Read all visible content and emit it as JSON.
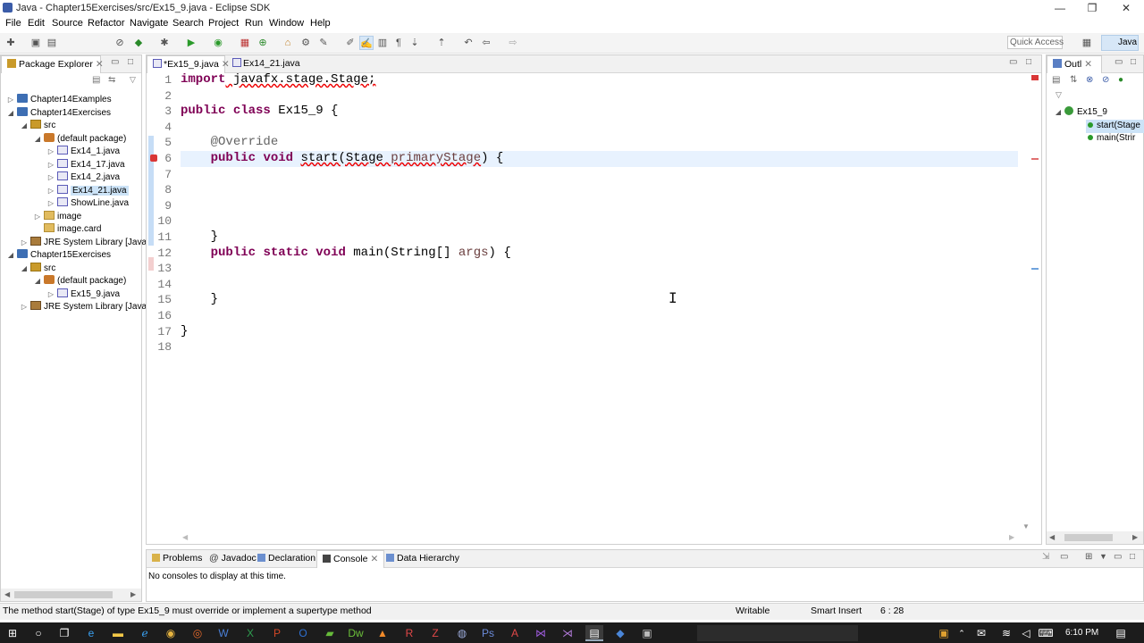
{
  "window": {
    "title": "Java - Chapter15Exercises/src/Ex15_9.java - Eclipse SDK",
    "minimize": "—",
    "restore": "❐",
    "close": "✕"
  },
  "menu": [
    "File",
    "Edit",
    "Source",
    "Refactor",
    "Navigate",
    "Search",
    "Project",
    "Run",
    "Window",
    "Help"
  ],
  "toolbar": {
    "quick_access_placeholder": "Quick Access",
    "perspective": "Java"
  },
  "package_explorer": {
    "title": "Package Explorer",
    "items": [
      {
        "label": "Chapter14Examples"
      },
      {
        "label": "Chapter14Exercises"
      },
      {
        "label": "src"
      },
      {
        "label": "(default package)"
      },
      {
        "label": "Ex14_1.java"
      },
      {
        "label": "Ex14_17.java"
      },
      {
        "label": "Ex14_2.java"
      },
      {
        "label": "Ex14_21.java"
      },
      {
        "label": "ShowLine.java"
      },
      {
        "label": "image"
      },
      {
        "label": "image.card"
      },
      {
        "label": "JRE System Library [JavaS"
      },
      {
        "label": "Chapter15Exercises"
      },
      {
        "label": "src"
      },
      {
        "label": "(default package)"
      },
      {
        "label": "Ex15_9.java"
      },
      {
        "label": "JRE System Library [JavaS"
      }
    ]
  },
  "editor": {
    "tabs": [
      {
        "label": "*Ex15_9.java"
      },
      {
        "label": "Ex14_21.java"
      }
    ],
    "line_numbers": [
      "1",
      "2",
      "3",
      "4",
      "5",
      "6",
      "7",
      "8",
      "9",
      "10",
      "11",
      "12",
      "13",
      "14",
      "15",
      "16",
      "17",
      "18"
    ],
    "code": {
      "l1_kw": "import",
      "l1_rest": " javafx.stage.Stage;",
      "l3_kw1": "public",
      "l3_kw2": "class",
      "l3_rest": " Ex15_9 {",
      "l5_ann": "@Override",
      "l6_kw1": "public",
      "l6_kw2": "void",
      "l6_method": "start",
      "l6_p1": "(Stage ",
      "l6_param": "primaryStage",
      "l6_p2": ") {",
      "l11": "}",
      "l12_kw1": "public",
      "l12_kw2": "static",
      "l12_kw3": "void",
      "l12_rest1": " main(String[] ",
      "l12_param": "args",
      "l12_rest2": ") {",
      "l15": "}",
      "l17": "}"
    }
  },
  "outline": {
    "title": "Outl",
    "class_name": "Ex15_9",
    "members": [
      {
        "label": "start(Stage"
      },
      {
        "label": "main(Strir"
      }
    ]
  },
  "bottom_panel": {
    "tabs": [
      {
        "label": "Problems"
      },
      {
        "label": "Javadoc"
      },
      {
        "label": "Declaration"
      },
      {
        "label": "Console"
      },
      {
        "label": "Data Hierarchy"
      }
    ],
    "message": "No consoles to display at this time."
  },
  "status_bar": {
    "message": "The method start(Stage) of type Ex15_9 must override or implement a supertype method",
    "writable": "Writable",
    "insert_mode": "Smart Insert",
    "position": "6 : 28"
  },
  "taskbar": {
    "time": "6:10 PM"
  },
  "colors": {
    "keyword": "#7f0055",
    "annotation": "#646464",
    "current_line": "#e8f2fe",
    "taskbar": "#1c1c1c"
  }
}
